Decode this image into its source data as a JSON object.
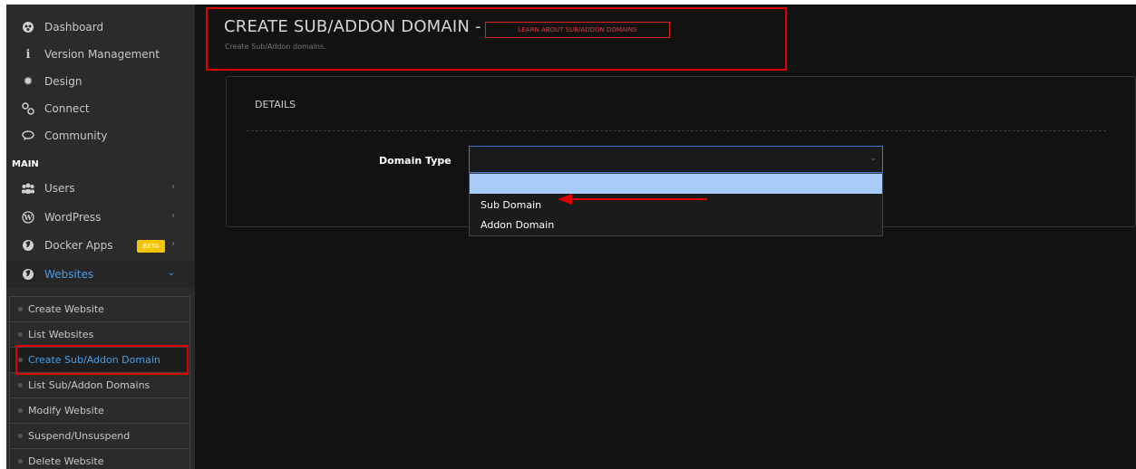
{
  "sidebar": {
    "nav": [
      {
        "label": "Dashboard",
        "icon": "dashboard-icon"
      },
      {
        "label": "Version Management",
        "icon": "info-icon"
      },
      {
        "label": "Design",
        "icon": "gear-icon"
      },
      {
        "label": "Connect",
        "icon": "connect-icon"
      },
      {
        "label": "Community",
        "icon": "chat-icon"
      }
    ],
    "section_label": "MAIN",
    "main_items": [
      {
        "label": "Users",
        "icon": "users-icon",
        "chevron": "›"
      },
      {
        "label": "WordPress",
        "icon": "wordpress-icon",
        "chevron": "›"
      },
      {
        "label": "Docker Apps",
        "icon": "globe-icon",
        "chevron": "›",
        "badge": "BETA"
      },
      {
        "label": "Websites",
        "icon": "globe-icon",
        "chevron": "⌄",
        "active": true
      }
    ],
    "submenu": [
      {
        "label": "Create Website"
      },
      {
        "label": "List Websites"
      },
      {
        "label": "Create Sub/Addon Domain",
        "active": true
      },
      {
        "label": "List Sub/Addon Domains"
      },
      {
        "label": "Modify Website"
      },
      {
        "label": "Suspend/Unsuspend"
      },
      {
        "label": "Delete Website"
      }
    ]
  },
  "header": {
    "title": "CREATE SUB/ADDON DOMAIN -",
    "learn_link": "LEARN ABOUT SUB/ADDON DOMAINS",
    "subtitle": "Create Sub/Addon domains."
  },
  "panel": {
    "heading": "DETAILS",
    "field_label": "Domain Type",
    "select_value": "",
    "caret": "⌄",
    "options": [
      "",
      "Sub Domain",
      "Addon Domain"
    ]
  },
  "colors": {
    "accent": "#4a9fe8",
    "highlight": "#e00000",
    "beta": "#f5c400",
    "option_highlight": "#a7ccf7"
  }
}
